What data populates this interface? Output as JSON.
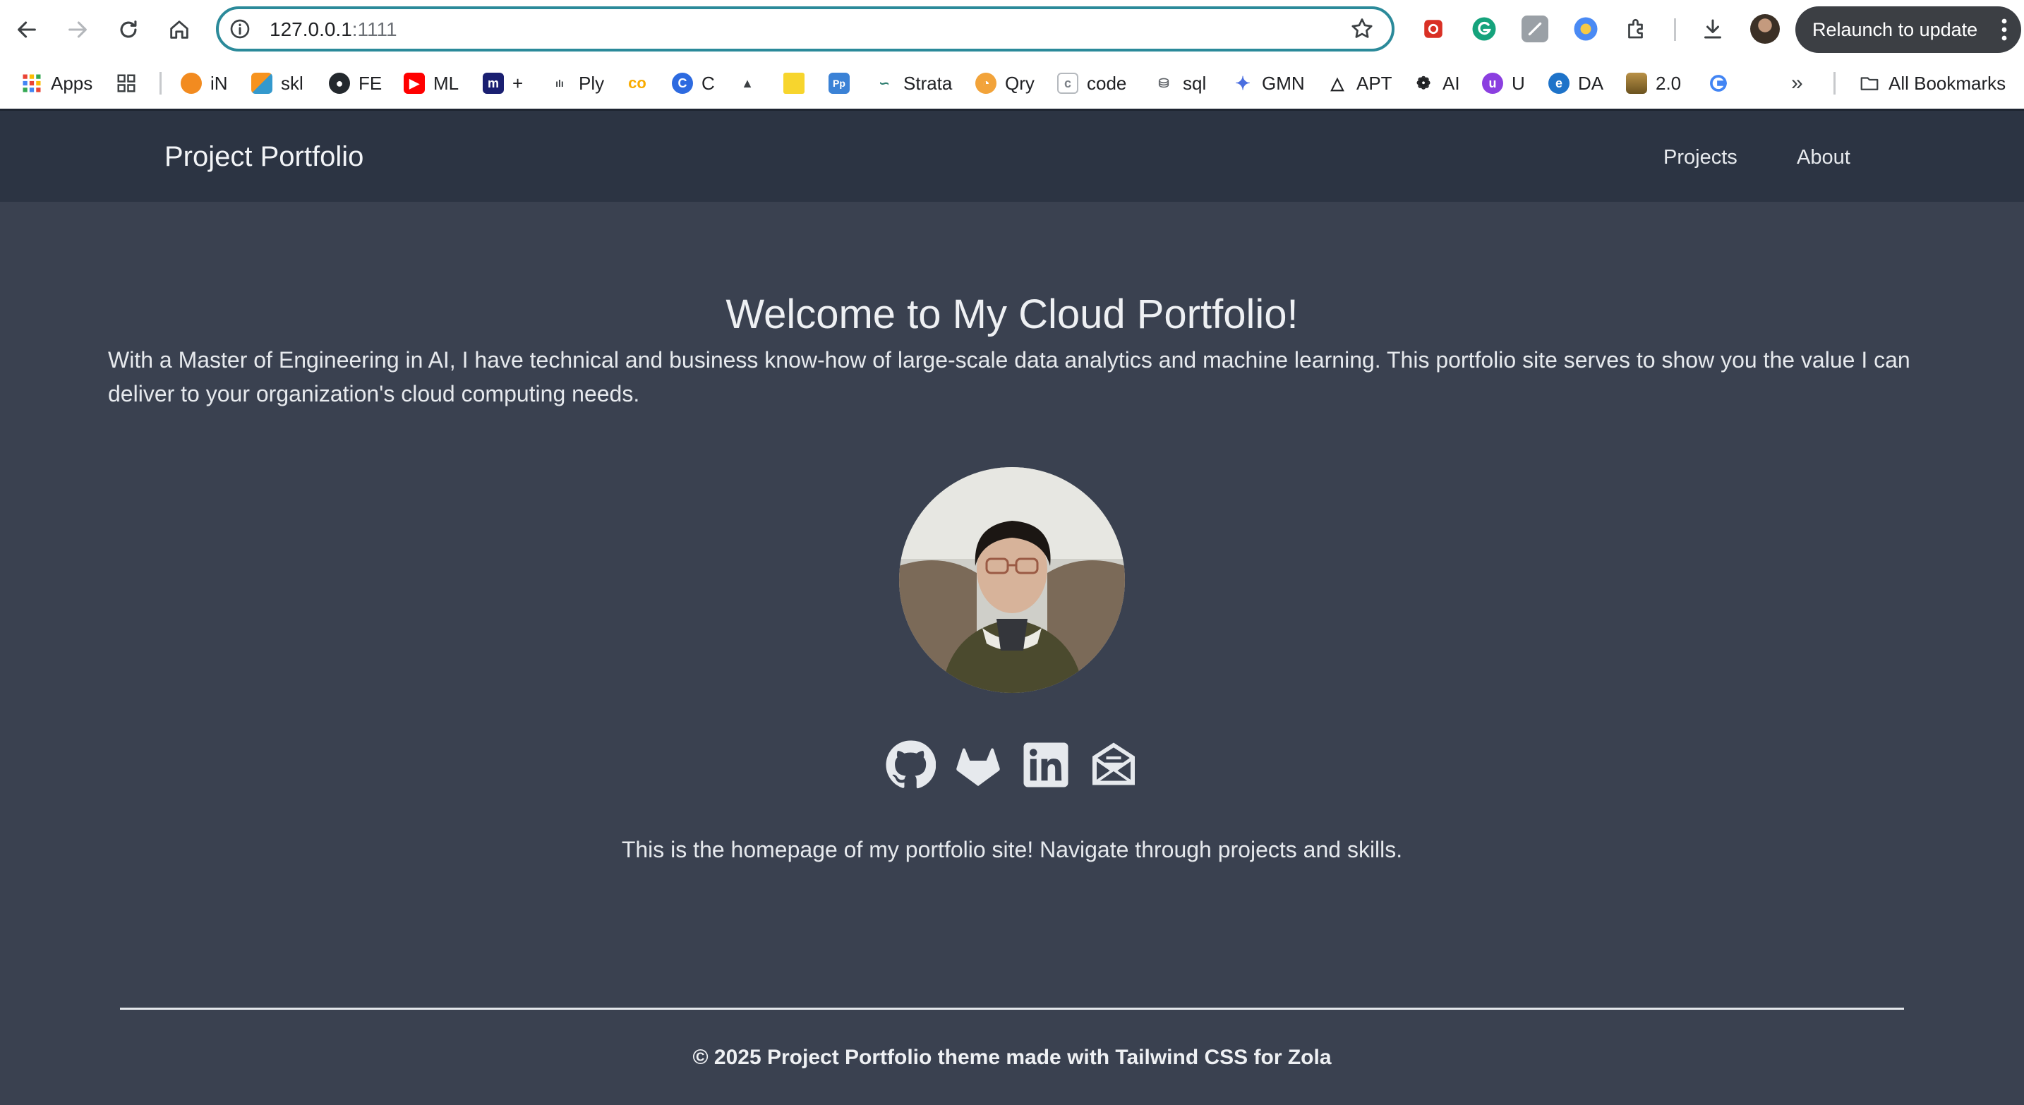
{
  "browser": {
    "url_host": "127.0.0.1",
    "url_port": ":1111",
    "relaunch_label": "Relaunch to update",
    "bookmarks": [
      {
        "label": "Apps",
        "icon": "apps-grid-icon"
      },
      {
        "label": "",
        "icon": "tab-groups-icon"
      },
      {
        "label": "iN",
        "icon": "orange-circle-icon"
      },
      {
        "label": "skl",
        "icon": "sklearn-icon"
      },
      {
        "label": "FE",
        "icon": "github-icon"
      },
      {
        "label": "ML",
        "icon": "youtube-icon"
      },
      {
        "label": "+",
        "icon": "m-icon"
      },
      {
        "label": "Ply",
        "icon": "plotly-icon"
      },
      {
        "label": "",
        "icon": "colab-icon"
      },
      {
        "label": "C",
        "icon": "c-icon"
      },
      {
        "label": "",
        "icon": "mountain-icon"
      },
      {
        "label": "",
        "icon": "yellow-note-icon"
      },
      {
        "label": "",
        "icon": "pp-icon"
      },
      {
        "label": "Strata",
        "icon": "strata-icon"
      },
      {
        "label": "Qry",
        "icon": "query-icon"
      },
      {
        "label": "code",
        "icon": "code-icon"
      },
      {
        "label": "sql",
        "icon": "sql-icon"
      },
      {
        "label": "GMN",
        "icon": "gemini-icon"
      },
      {
        "label": "APT",
        "icon": "apt-icon"
      },
      {
        "label": "AI",
        "icon": "openai-icon"
      },
      {
        "label": "U",
        "icon": "u-icon"
      },
      {
        "label": "DA",
        "icon": "da-icon"
      },
      {
        "label": "2.0",
        "icon": "road-icon"
      },
      {
        "label": "",
        "icon": "google-icon"
      }
    ],
    "all_bookmarks_label": "All Bookmarks"
  },
  "site": {
    "title": "Project Portfolio",
    "nav": {
      "projects": "Projects",
      "about": "About"
    },
    "welcome": "Welcome to My Cloud Portfolio!",
    "intro": "With a Master of Engineering in AI, I have technical and business know-how of large-scale data analytics and machine learning. This portfolio site serves to show you the value I can deliver to your organization's cloud computing needs.",
    "home_text": "This is the homepage of my portfolio site! Navigate through projects and skills.",
    "footer": "© 2025 Project Portfolio theme made with Tailwind CSS for Zola",
    "social": [
      "github-icon",
      "gitlab-icon",
      "linkedin-icon",
      "email-icon"
    ]
  },
  "colors": {
    "page_bg": "#3a4150",
    "header_bg": "#2c3443",
    "address_ring": "#2b8a9a"
  }
}
